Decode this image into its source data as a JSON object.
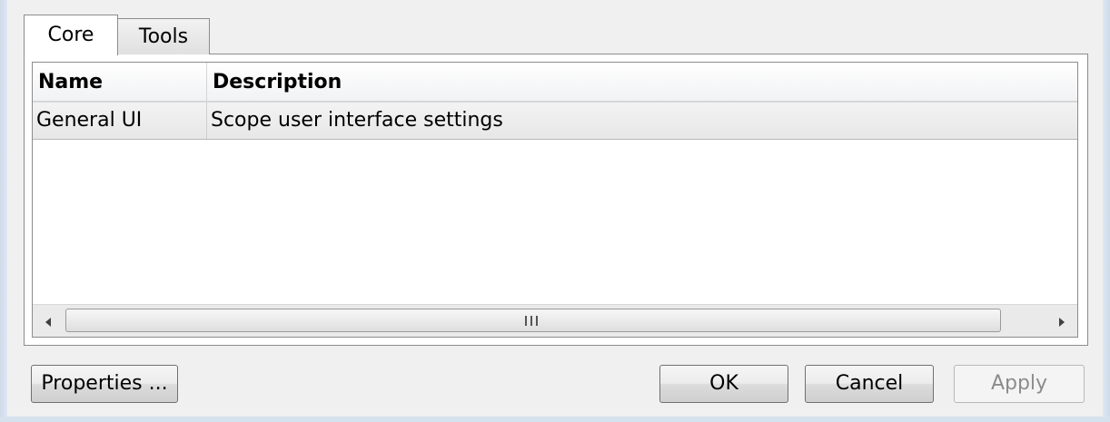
{
  "tabs": [
    {
      "label": "Core",
      "selected": true
    },
    {
      "label": "Tools",
      "selected": false
    }
  ],
  "table": {
    "columns": [
      "Name",
      "Description"
    ],
    "rows": [
      {
        "name": "General UI",
        "description": "Scope user interface settings"
      }
    ]
  },
  "scrollbar": {
    "grip_label": "III",
    "left_arrow_icon": "triangle-left-icon",
    "right_arrow_icon": "triangle-right-icon"
  },
  "buttons": {
    "properties": "Properties ...",
    "ok": "OK",
    "cancel": "Cancel",
    "apply": "Apply"
  },
  "colors": {
    "window_background": "#f0f0f0",
    "frame": "#cfdbea",
    "selected_row": "#ebebeb",
    "disabled_text": "#8c8c8c"
  }
}
